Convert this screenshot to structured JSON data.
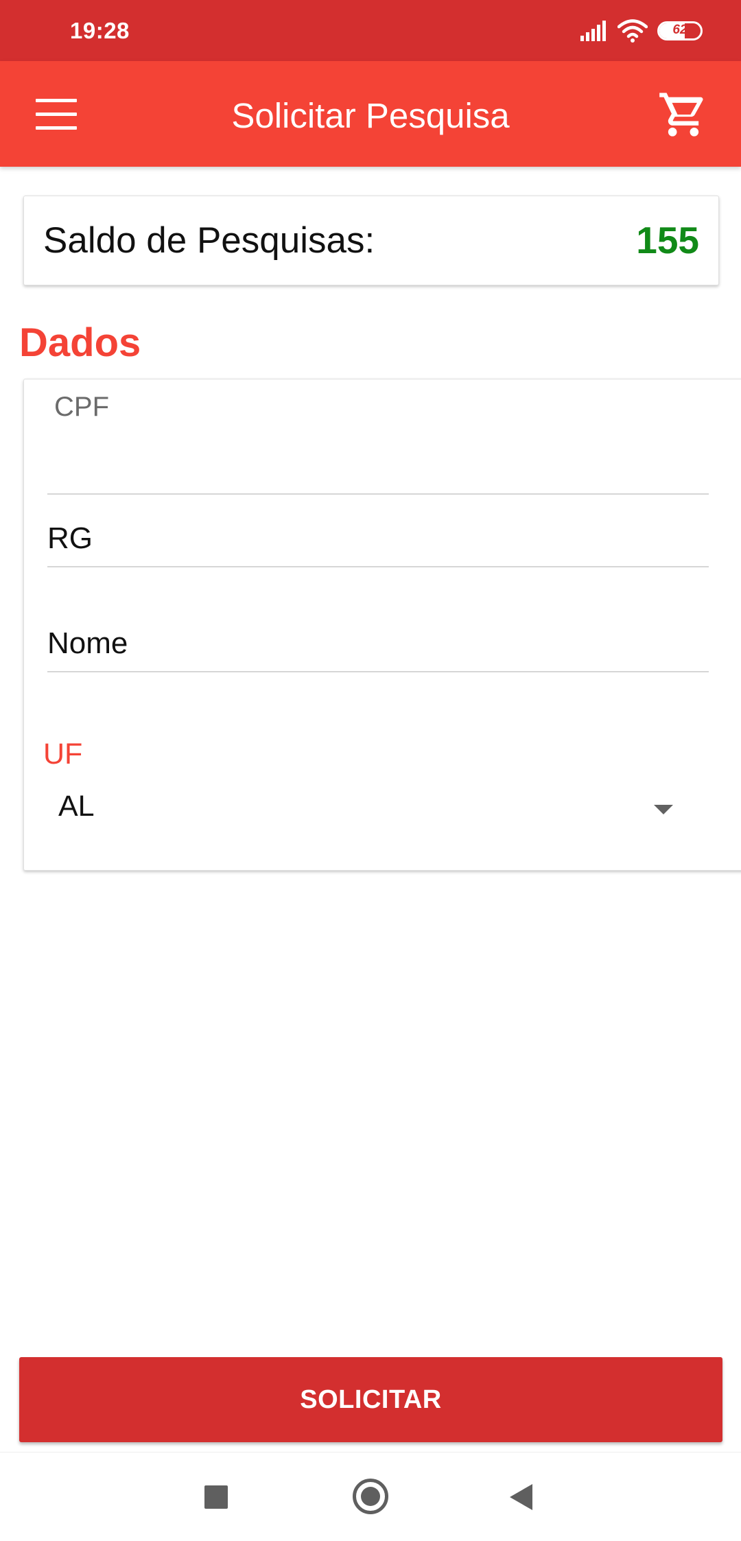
{
  "status_bar": {
    "time": "19:28",
    "battery_percent": "62",
    "battery_level": 0.62,
    "icons": [
      "signal-icon",
      "wifi-icon",
      "battery-icon"
    ]
  },
  "app_bar": {
    "title": "Solicitar Pesquisa",
    "menu_icon": "menu-icon",
    "cart_icon": "cart-icon",
    "background_color": "#f44336"
  },
  "balance": {
    "label": "Saldo de Pesquisas:",
    "value": "155",
    "value_color": "#118a18"
  },
  "section": {
    "title": "Dados"
  },
  "form": {
    "cpf": {
      "label": "CPF",
      "value": ""
    },
    "rg": {
      "placeholder": "RG",
      "value": ""
    },
    "nome": {
      "placeholder": "Nome",
      "value": ""
    },
    "uf": {
      "label": "UF",
      "selected": "AL"
    }
  },
  "submit": {
    "label": "SOLICITAR",
    "color": "#d32f2f"
  },
  "nav_bar": {
    "icons": [
      "recent-apps-icon",
      "home-icon",
      "back-icon"
    ]
  }
}
